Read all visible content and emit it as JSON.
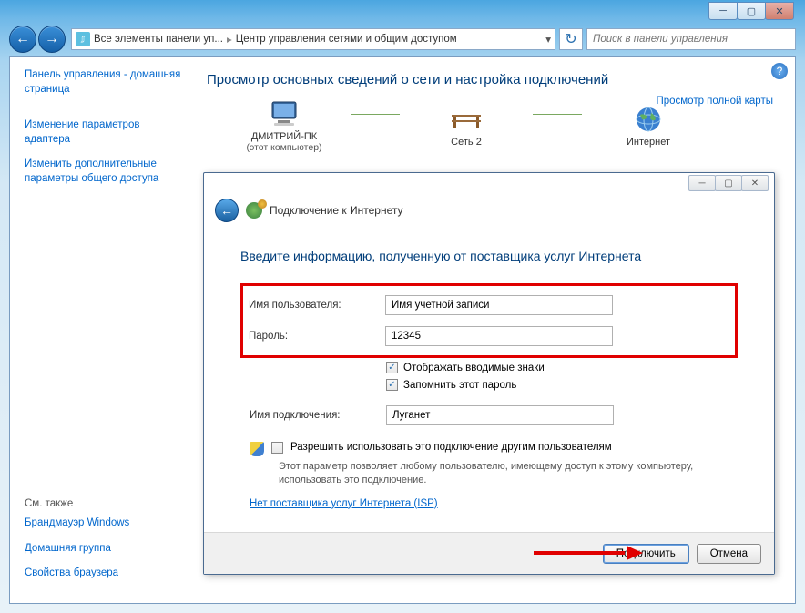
{
  "toolbar": {
    "breadcrumb1": "Все элементы панели уп...",
    "breadcrumb2": "Центр управления сетями и общим доступом",
    "search_placeholder": "Поиск в панели управления"
  },
  "sidebar": {
    "home": "Панель управления - домашняя страница",
    "adapter": "Изменение параметров адаптера",
    "sharing": "Изменить дополнительные параметры общего доступа",
    "see_also": "См. также",
    "firewall": "Брандмауэр Windows",
    "homegroup": "Домашняя группа",
    "browser": "Свойства браузера"
  },
  "main": {
    "title": "Просмотр основных сведений о сети и настройка подключений",
    "full_map": "Просмотр полной карты",
    "node1": "ДМИТРИЙ-ПК",
    "node1_sub": "(этот компьютер)",
    "node2": "Сеть 2",
    "node3": "Интернет"
  },
  "wizard": {
    "title": "Подключение к Интернету",
    "heading": "Введите информацию, полученную от поставщика услуг Интернета",
    "username_label": "Имя пользователя:",
    "username_value": "Имя учетной записи",
    "password_label": "Пароль:",
    "password_value": "12345",
    "show_chars": "Отображать вводимые знаки",
    "remember": "Запомнить этот пароль",
    "conn_name_label": "Имя подключения:",
    "conn_name_value": "Луганет",
    "allow_others": "Разрешить использовать это подключение другим пользователям",
    "allow_desc": "Этот параметр позволяет любому пользователю, имеющему доступ к этому компьютеру, использовать это подключение.",
    "no_isp": "Нет поставщика услуг Интернета (ISP)",
    "connect": "Подключить",
    "cancel": "Отмена"
  }
}
